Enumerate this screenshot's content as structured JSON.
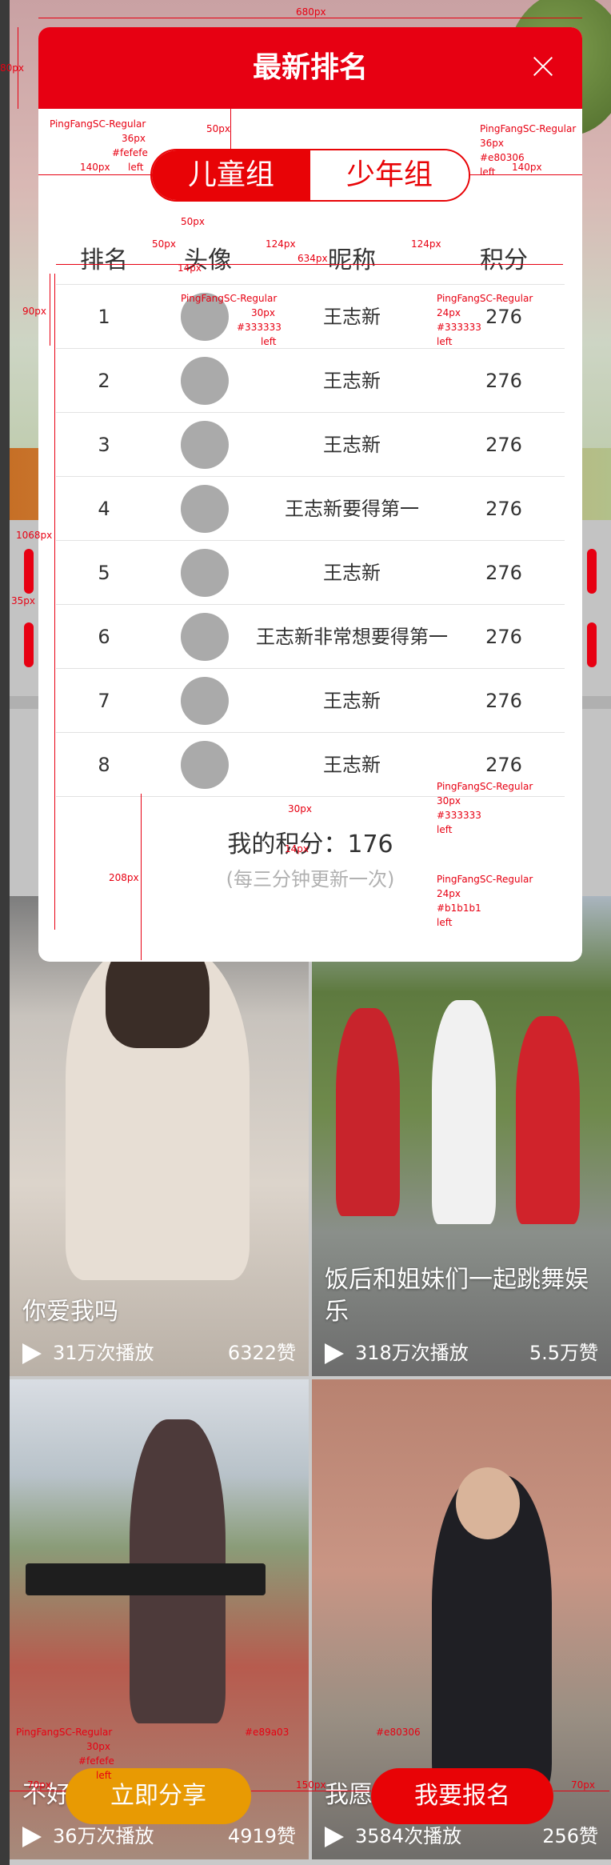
{
  "design_size_label": "680px",
  "modal": {
    "title": "最新排名",
    "tabs": [
      {
        "label": "儿童组",
        "active": true
      },
      {
        "label": "少年组",
        "active": false
      }
    ],
    "headers": {
      "rank": "排名",
      "avatar": "头像",
      "name": "昵称",
      "score": "积分"
    },
    "rows": [
      {
        "rank": "1",
        "name": "王志新",
        "score": "276"
      },
      {
        "rank": "2",
        "name": "王志新",
        "score": "276"
      },
      {
        "rank": "3",
        "name": "王志新",
        "score": "276"
      },
      {
        "rank": "4",
        "name": "王志新要得第一",
        "score": "276"
      },
      {
        "rank": "5",
        "name": "王志新",
        "score": "276"
      },
      {
        "rank": "6",
        "name": "王志新非常想要得第一",
        "score": "276"
      },
      {
        "rank": "7",
        "name": "王志新",
        "score": "276"
      },
      {
        "rank": "8",
        "name": "王志新",
        "score": "276"
      }
    ],
    "my_score_label": "我的积分：",
    "my_score_value": "176",
    "update_note": "(每三分钟更新一次)"
  },
  "videos": [
    {
      "title": "你爱我吗",
      "plays": "31万次播放",
      "likes": "6322赞"
    },
    {
      "title": "饭后和姐妹们一起跳舞娱乐",
      "plays": "318万次播放",
      "likes": "5.5万赞"
    },
    {
      "title": "不好",
      "plays": "36万次播放",
      "likes": "4919赞"
    },
    {
      "title": "我愿",
      "plays": "3584次播放",
      "likes": "256赞"
    }
  ],
  "actions": {
    "share_label": "立即分享",
    "signup_label": "我要报名"
  },
  "annotations": {
    "m40a": "40px",
    "m40b": "40px",
    "m140l": "140px",
    "m140r": "140px",
    "m50a": "50px",
    "m50b": "50px",
    "m50c": "50px",
    "m14a": "14px",
    "m124a": "124px",
    "m124b": "124px",
    "m634": "634px",
    "m90": "90px",
    "m1068": "1068px",
    "m35": "35px",
    "m30": "30px",
    "m14b": "14px",
    "m208": "208px",
    "m70l": "70px",
    "m150": "150px",
    "m70r": "70px",
    "m80": "80px",
    "spec_title": [
      "PingFangSC-Regular",
      "36px",
      "#fefefe",
      "left"
    ],
    "spec_tab": [
      "PingFangSC-Regular",
      "36px",
      "#e80306",
      "left"
    ],
    "spec_rank": [
      "PingFangSC-Regular",
      "30px",
      "#333333",
      "left"
    ],
    "spec_name": [
      "PingFangSC-Regular",
      "24px",
      "#333333",
      "left"
    ],
    "spec_my": [
      "PingFangSC-Regular",
      "30px",
      "#333333",
      "left"
    ],
    "spec_note": [
      "PingFangSC-Regular",
      "24px",
      "#b1b1b1",
      "left"
    ],
    "spec_share": [
      "PingFangSC-Regular",
      "30px",
      "#fefefe",
      "left"
    ],
    "spec_share_color": "#e89a03",
    "spec_signup_color": "#e80306"
  },
  "colors": {
    "brand_red": "#e70012",
    "tab_red": "#e80306",
    "share_orange": "#e89a03",
    "text": "#333333",
    "muted": "#b1b1b1"
  }
}
